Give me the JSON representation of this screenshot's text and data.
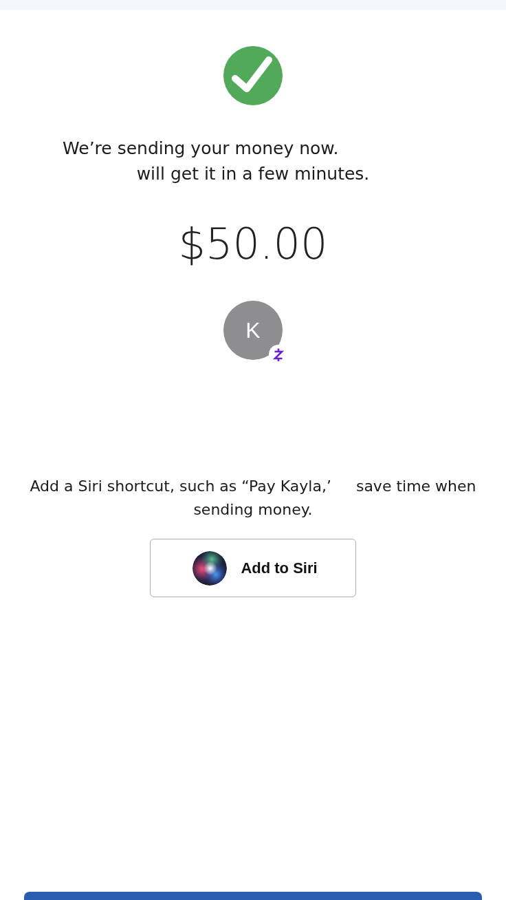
{
  "status": {
    "kind": "success"
  },
  "message": {
    "lines": [
      "We’re sending your money now.",
      "will get it in a few minutes."
    ]
  },
  "amount": "$50.00",
  "recipient": {
    "initial": "K",
    "network_badge": true
  },
  "siri_prompt": {
    "lines": [
      {
        "parts": [
          "Add a Siri shortcut, such as “Pay Kayla,’",
          "save time when"
        ]
      },
      {
        "parts": [
          "sending money."
        ]
      }
    ]
  },
  "siri_button": {
    "label": "Add to Siri"
  },
  "bottom_button": {
    "visible": true
  }
}
